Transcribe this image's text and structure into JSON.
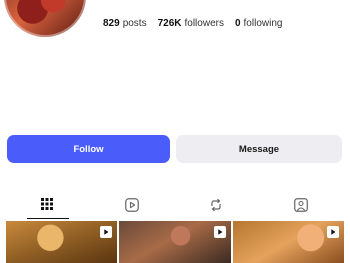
{
  "profile": {
    "stats": [
      {
        "value": "829",
        "label": "posts"
      },
      {
        "value": "726K",
        "label": "followers"
      },
      {
        "value": "0",
        "label": "following"
      }
    ]
  },
  "actions": {
    "follow_label": "Follow",
    "message_label": "Message",
    "follow_color": "#4a5dfb",
    "message_color": "#eeeef2"
  },
  "tabs": [
    {
      "icon": "grid-icon",
      "active": true
    },
    {
      "icon": "reels-icon",
      "active": false
    },
    {
      "icon": "reposts-icon",
      "active": false
    },
    {
      "icon": "tagged-icon",
      "active": false
    }
  ],
  "posts": [
    {
      "type": "reel"
    },
    {
      "type": "reel"
    },
    {
      "type": "reel"
    }
  ]
}
